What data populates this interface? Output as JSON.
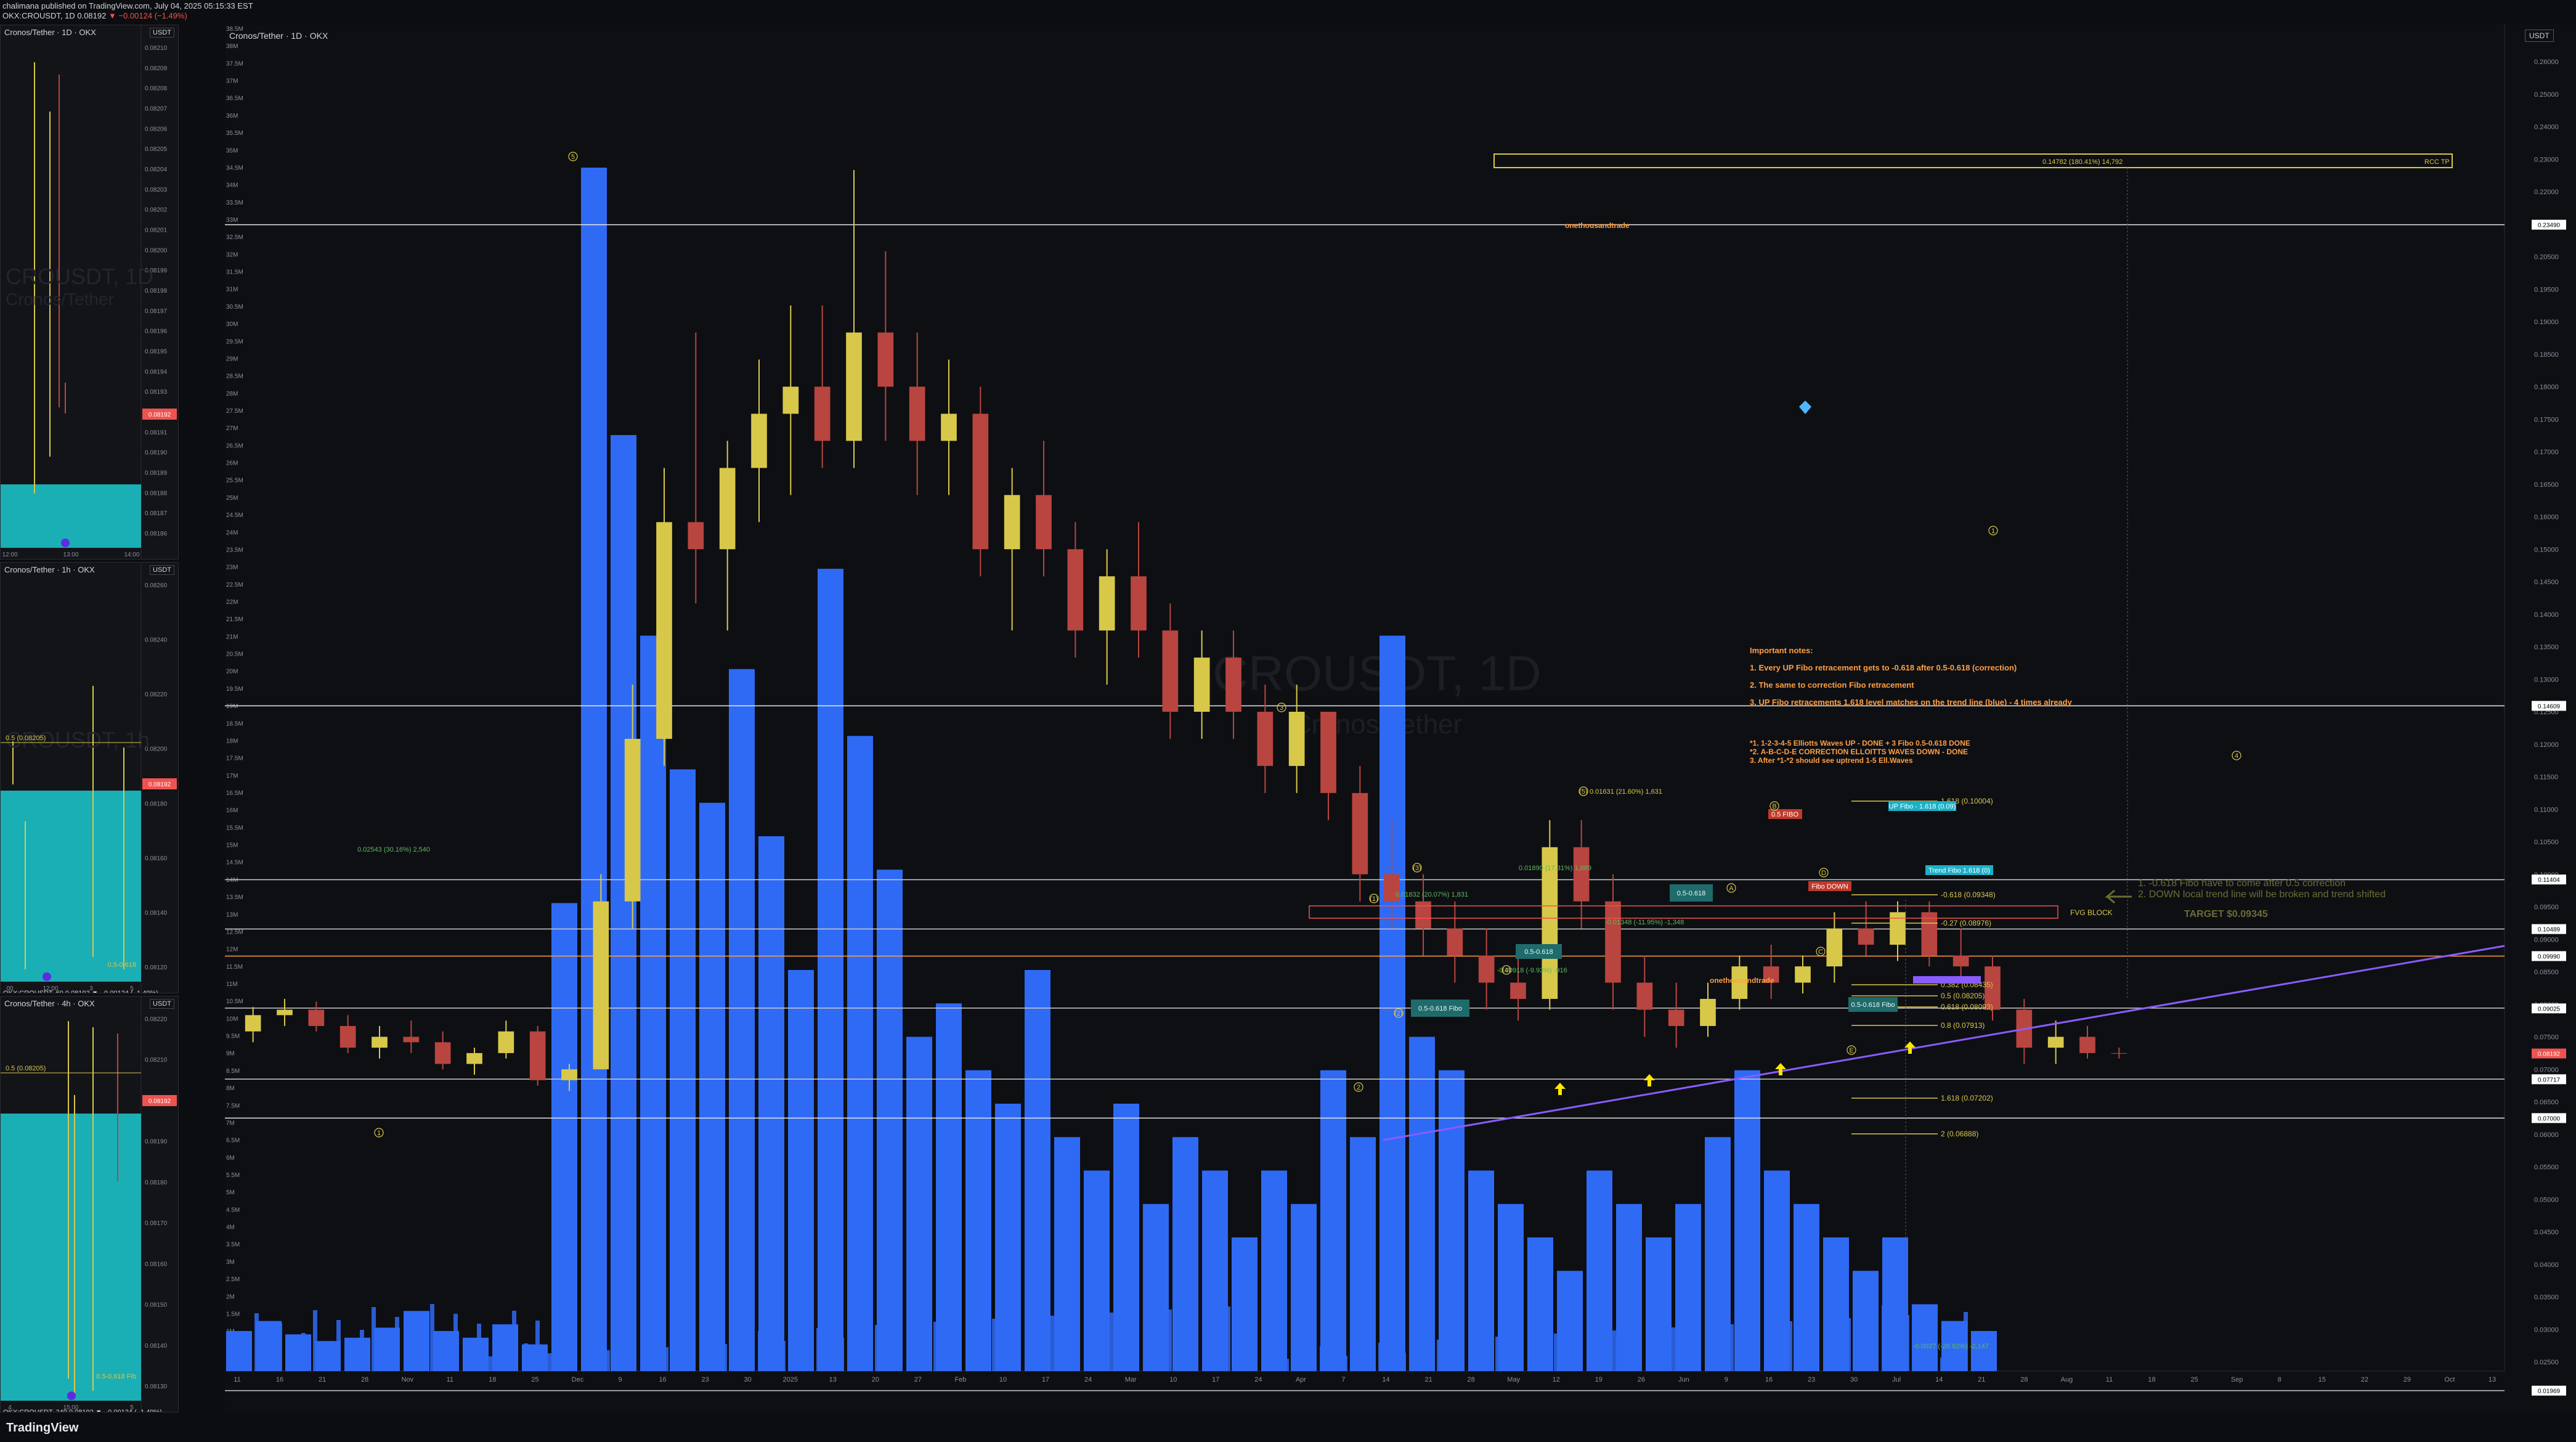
{
  "header": {
    "publish_line": "chalimana published on TradingView.com, July 04, 2025 05:15:33 EST",
    "ohlc_line_prefix": "OKX:CROUSDT, 1D 0.08192",
    "ohlc_change": "▼ −0.00124 (−1.49%)",
    "ohlc_line2": "OKX:CROUSDT, 1D  O:0.08314 H:0.08325 L:0.08130 C:0.08192"
  },
  "main": {
    "title": "Cronos/Tether · 1D · OKX",
    "currency": "USDT",
    "watermark_symbol": "CROUSDT, 1D",
    "watermark_name": "Cronos/Tether",
    "brand": "TradingView"
  },
  "side_panels": [
    {
      "title": "Cronos/Tether · 1D · OKX",
      "currency": "USDT",
      "watermark": "CROUSDT, 1D",
      "watermark2": "Cronos/Tether",
      "price_labels": [
        "0.08210",
        "0.08209",
        "0.08208",
        "0.08207",
        "0.08206",
        "0.08205",
        "0.08204",
        "0.08203",
        "0.08202",
        "0.08201",
        "0.08200",
        "0.08199",
        "0.08198",
        "0.08197",
        "0.08196",
        "0.08195",
        "0.08194",
        "0.08193",
        "0.08192",
        "0.08191",
        "0.08190",
        "0.08189",
        "0.08188",
        "0.08187",
        "0.08186"
      ],
      "time_labels": [
        "12:00",
        "13:00",
        "14:00"
      ],
      "current": "0.08192"
    },
    {
      "title": "Cronos/Tether · 1h · OKX",
      "currency": "USDT",
      "watermark": "CROUSDT, 1h",
      "ohlc": "OKX:CROUSDT, 60 0.08192 ▼ −0.00124 (−1.49%)",
      "price_labels": [
        "0.08260",
        "0.08240",
        "0.08220",
        "0.08200",
        "0.08180",
        "0.08160",
        "0.08140",
        "0.08120"
      ],
      "time_labels": [
        "00",
        "12:00",
        "3",
        "5"
      ],
      "current": "0.08192",
      "fib_label": "0.5 (0.08205)",
      "fib2": "0.5-0.618"
    },
    {
      "title": "Cronos/Tether · 4h · OKX",
      "currency": "USDT",
      "ohlc": "OKX:CROUSDT, 240 0.08192 ▼ −0.00124 (−1.49%)",
      "price_labels": [
        "0.08220",
        "0.08210",
        "0.08200",
        "0.08190",
        "0.08180",
        "0.08170",
        "0.08160",
        "0.08150",
        "0.08140",
        "0.08130"
      ],
      "time_labels": [
        "4",
        "15:00",
        "5"
      ],
      "current": "0.08192",
      "fib_label": "0.5 (0.08205)",
      "fib2": "0.5-0.618 Fib"
    }
  ],
  "annotations": {
    "brand_tag": "onethousandtrade",
    "brand_tag2": "onethousandtrade",
    "important_title": "Important notes:",
    "note1": "1. Every UP Fibo retracement gets to -0.618 after 0.5-0.618 (correction)",
    "note2": "2. The same to correction Fibo retracement",
    "note3": "3. UP Fibo retracements 1.618 level matches on the trend line (blue) - 4 times already",
    "wave1": "*1. 1-2-3-4-5 Elliotts Waves UP - DONE  + 3 Fibo 0.5-0.618 DONE",
    "wave2": "*2. A-B-C-D-E CORRECTION ELLOITTS WAVES DOWN - DONE",
    "wave3": "3. After *1-*2 should see uptrend 1-5 Ell.Waves",
    "right1": "1. -0.618 Fibo have to come after 0.5 correction",
    "right2": "2. DOWN local trend line will be broken and trend shifted",
    "target": "TARGET $0.09345",
    "fvg": "FVG BLOCK",
    "tp_box": "0.14782 (180.41%) 14,792",
    "tp_tag": "RCC TP",
    "fib_up": "UP Fibo - 1.618 (0.09)",
    "fib_trend": "Trend Fibo 1.618 (0)",
    "fib_down": "Fibo DOWN",
    "fib_b": "0.5 FIBO",
    "fib_1618": "1.618 (0.10004)",
    "fib_m0618": "-0.618 (0.09348)",
    "fib_m027": "-0.27 (0.08976)",
    "fib_0382": "0.382 (0.08435)",
    "fib_05": "0.5 (0.08205)",
    "fib_0618": "0.618 (0.08093)",
    "fib_08": "0.8 (0.07913)",
    "fib_1618b": "1.618 (0.07202)",
    "fib_2": "2 (0.06888)",
    "box_a": "0.5-0.618 Fibo",
    "box_b": "0.5-0.618",
    "box_c": "0.5-0.618",
    "box_d": "0.5-0.618 Fibo",
    "pct_a": "0.02543 (30.16%) 2,540",
    "pct_b": "0.01832 (20.07%) 1,831",
    "pct_c": "0.01890 (17.31%) 1,889",
    "pct_d": "0.01631 (21.60%) 1,631",
    "pct_e": "-0.01348 (-11.95%) -1,348",
    "pct_f": "-0.00918 (-9.93%) -916",
    "pct_g": "-0.0027 (-26.92%) -2,147",
    "w1": "1",
    "w2": "2",
    "w3": "3",
    "w4": "4",
    "w5": "5",
    "wA": "A",
    "wB": "B",
    "wC": "C",
    "wD": "D",
    "wE": "E",
    "w_1p": "(1)",
    "w_2p": "(2)",
    "w_3p": "(3)",
    "w_4p": "(4)",
    "w_5p": "(5)"
  },
  "chart_data": {
    "type": "candlestick",
    "title": "Cronos/Tether · 1D · OKX",
    "y_axis_price_labels": [
      "0.26000",
      "0.25000",
      "0.24000",
      "0.23000",
      "0.22000",
      "0.21000",
      "0.20500",
      "0.19500",
      "0.19000",
      "0.18500",
      "0.18000",
      "0.17500",
      "0.17000",
      "0.16500",
      "0.16000",
      "0.15000",
      "0.14500",
      "0.14000",
      "0.13500",
      "0.13000",
      "0.12500",
      "0.12000",
      "0.11500",
      "0.11000",
      "0.10500",
      "0.10000",
      "0.09500",
      "0.09000",
      "0.08500",
      "0.08000",
      "0.07500",
      "0.07000",
      "0.06500",
      "0.06000",
      "0.05500",
      "0.05000",
      "0.04500",
      "0.04000",
      "0.03500",
      "0.03000",
      "0.02500"
    ],
    "y_axis_volume_labels": [
      "38.5M",
      "38M",
      "37.5M",
      "37M",
      "36.5M",
      "36M",
      "35.5M",
      "35M",
      "34.5M",
      "34M",
      "33.5M",
      "33M",
      "32.5M",
      "32M",
      "31.5M",
      "31M",
      "30.5M",
      "30M",
      "29.5M",
      "29M",
      "28.5M",
      "28M",
      "27.5M",
      "27M",
      "26.5M",
      "26M",
      "25.5M",
      "25M",
      "24.5M",
      "24M",
      "23.5M",
      "23M",
      "22.5M",
      "22M",
      "21.5M",
      "21M",
      "20.5M",
      "20M",
      "19.5M",
      "19M",
      "18.5M",
      "18M",
      "17.5M",
      "17M",
      "16.5M",
      "16M",
      "15.5M",
      "15M",
      "14.5M",
      "14M",
      "13.5M",
      "13M",
      "12.5M",
      "12M",
      "11.5M",
      "11M",
      "10.5M",
      "10M",
      "9.5M",
      "9M",
      "8.5M",
      "8M",
      "7.5M",
      "7M",
      "6.5M",
      "6M",
      "5.5M",
      "5M",
      "4.5M",
      "4M",
      "3.5M",
      "3M",
      "2.5M",
      "2M",
      "1.5M",
      "1M",
      "500K",
      "0"
    ],
    "x_axis_labels": [
      "11",
      "16",
      "21",
      "28",
      "Nov",
      "11",
      "18",
      "25",
      "Dec",
      "9",
      "16",
      "23",
      "30",
      "2025",
      "13",
      "20",
      "27",
      "Feb",
      "10",
      "17",
      "24",
      "Mar",
      "10",
      "17",
      "24",
      "Apr",
      "7",
      "14",
      "21",
      "28",
      "May",
      "12",
      "19",
      "26",
      "Jun",
      "9",
      "16",
      "23",
      "30",
      "Jul",
      "14",
      "21",
      "28",
      "Aug",
      "11",
      "18",
      "25",
      "Sep",
      "8",
      "15",
      "22",
      "29",
      "Oct",
      "13"
    ],
    "current_price": "0.08192",
    "price_tags": [
      "0.23490",
      "0.14609",
      "0.11404",
      "0.10489",
      "0.09990",
      "0.09025",
      "0.08192",
      "0.07717",
      "0.07000",
      "0.01969"
    ],
    "ylim": [
      0.025,
      0.265
    ],
    "ohlc": [
      [
        0.086,
        0.0905,
        0.084,
        0.089
      ],
      [
        0.089,
        0.092,
        0.087,
        0.09
      ],
      [
        0.09,
        0.0915,
        0.086,
        0.087
      ],
      [
        0.087,
        0.089,
        0.082,
        0.083
      ],
      [
        0.083,
        0.087,
        0.081,
        0.085
      ],
      [
        0.085,
        0.088,
        0.082,
        0.084
      ],
      [
        0.084,
        0.086,
        0.079,
        0.08
      ],
      [
        0.08,
        0.083,
        0.078,
        0.082
      ],
      [
        0.082,
        0.088,
        0.081,
        0.086
      ],
      [
        0.086,
        0.087,
        0.076,
        0.077
      ],
      [
        0.077,
        0.08,
        0.075,
        0.079
      ],
      [
        0.079,
        0.115,
        0.079,
        0.11
      ],
      [
        0.11,
        0.15,
        0.105,
        0.14
      ],
      [
        0.14,
        0.19,
        0.135,
        0.18
      ],
      [
        0.18,
        0.215,
        0.165,
        0.175
      ],
      [
        0.175,
        0.195,
        0.16,
        0.19
      ],
      [
        0.19,
        0.21,
        0.18,
        0.2
      ],
      [
        0.2,
        0.22,
        0.185,
        0.205
      ],
      [
        0.205,
        0.22,
        0.19,
        0.195
      ],
      [
        0.195,
        0.245,
        0.19,
        0.215
      ],
      [
        0.215,
        0.23,
        0.195,
        0.205
      ],
      [
        0.205,
        0.215,
        0.185,
        0.195
      ],
      [
        0.195,
        0.21,
        0.185,
        0.2
      ],
      [
        0.2,
        0.205,
        0.17,
        0.175
      ],
      [
        0.175,
        0.19,
        0.16,
        0.185
      ],
      [
        0.185,
        0.195,
        0.17,
        0.175
      ],
      [
        0.175,
        0.18,
        0.155,
        0.16
      ],
      [
        0.16,
        0.175,
        0.15,
        0.17
      ],
      [
        0.17,
        0.18,
        0.155,
        0.16
      ],
      [
        0.16,
        0.165,
        0.14,
        0.145
      ],
      [
        0.145,
        0.16,
        0.14,
        0.155
      ],
      [
        0.155,
        0.16,
        0.14,
        0.145
      ],
      [
        0.145,
        0.15,
        0.13,
        0.135
      ],
      [
        0.135,
        0.15,
        0.13,
        0.145
      ],
      [
        0.145,
        0.145,
        0.125,
        0.13
      ],
      [
        0.13,
        0.135,
        0.11,
        0.115
      ],
      [
        0.115,
        0.125,
        0.105,
        0.11
      ],
      [
        0.11,
        0.115,
        0.1,
        0.105
      ],
      [
        0.105,
        0.11,
        0.095,
        0.1
      ],
      [
        0.1,
        0.105,
        0.09,
        0.095
      ],
      [
        0.095,
        0.1,
        0.088,
        0.092
      ],
      [
        0.092,
        0.125,
        0.09,
        0.12
      ],
      [
        0.12,
        0.125,
        0.105,
        0.11
      ],
      [
        0.11,
        0.115,
        0.09,
        0.095
      ],
      [
        0.095,
        0.1,
        0.085,
        0.09
      ],
      [
        0.09,
        0.095,
        0.083,
        0.087
      ],
      [
        0.087,
        0.095,
        0.085,
        0.092
      ],
      [
        0.092,
        0.1,
        0.09,
        0.098
      ],
      [
        0.098,
        0.102,
        0.092,
        0.095
      ],
      [
        0.095,
        0.1,
        0.093,
        0.098
      ],
      [
        0.098,
        0.108,
        0.095,
        0.105
      ],
      [
        0.105,
        0.11,
        0.1,
        0.102
      ],
      [
        0.102,
        0.11,
        0.099,
        0.108
      ],
      [
        0.108,
        0.11,
        0.098,
        0.1
      ],
      [
        0.1,
        0.105,
        0.095,
        0.098
      ],
      [
        0.098,
        0.1,
        0.088,
        0.09
      ],
      [
        0.09,
        0.092,
        0.08,
        0.083
      ],
      [
        0.083,
        0.088,
        0.08,
        0.085
      ],
      [
        0.085,
        0.087,
        0.081,
        0.082
      ],
      [
        0.082,
        0.083,
        0.081,
        0.0819
      ]
    ],
    "volume_M": [
      1.2,
      1.5,
      1.1,
      0.9,
      1.0,
      1.3,
      1.8,
      1.2,
      1.0,
      1.4,
      0.8,
      14,
      36,
      28,
      22,
      18,
      17,
      21,
      16,
      12,
      24,
      19,
      15,
      10,
      11,
      9,
      8,
      12,
      7,
      6,
      8,
      5,
      7,
      6,
      4,
      6,
      5,
      9,
      7,
      22,
      10,
      9,
      6,
      5,
      4,
      3,
      6,
      5,
      4,
      5,
      7,
      9,
      6,
      5,
      4,
      3,
      4,
      2,
      1.5,
      1.2
    ]
  }
}
